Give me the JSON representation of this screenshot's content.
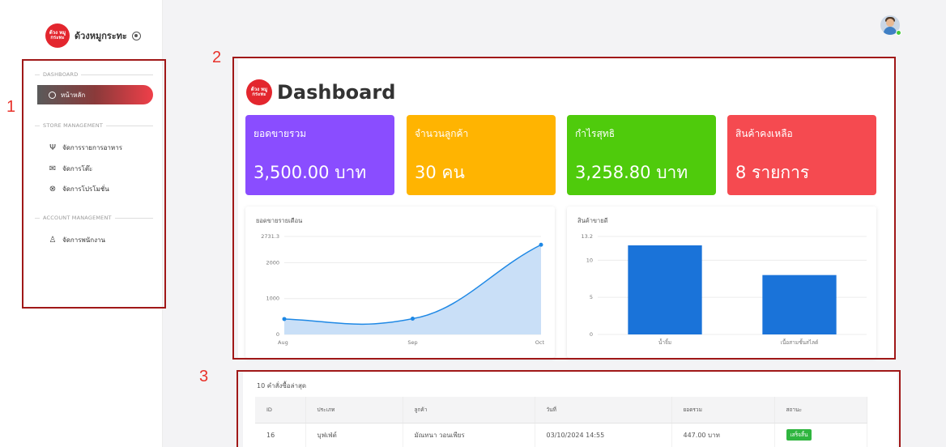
{
  "brand": {
    "logo_text": "ด้วง หมูกระทะ",
    "name": "ด้วงหมูกระทะ"
  },
  "sidebar": {
    "sections": [
      {
        "title": "DASHBOARD"
      },
      {
        "title": "STORE MANAGEMENT"
      },
      {
        "title": "ACCOUNT MANAGEMENT"
      }
    ],
    "active_item": {
      "label": "หน้าหลัก",
      "icon": "dashboard-icon"
    },
    "items": [
      {
        "label": "จัดการรายการอาหาร",
        "icon": "utensils-icon"
      },
      {
        "label": "จัดการโต๊ะ",
        "icon": "table-icon"
      },
      {
        "label": "จัดการโปรโมชั่น",
        "icon": "discount-icon"
      },
      {
        "label": "จัดการพนักงาน",
        "icon": "user-icon"
      }
    ]
  },
  "dashboard": {
    "title": "Dashboard",
    "stats": [
      {
        "label": "ยอดขายรวม",
        "value": "3,500.00 บาท",
        "color": "#8a4dff"
      },
      {
        "label": "จำนวนลูกค้า",
        "value": "30 คน",
        "color": "#ffb401"
      },
      {
        "label": "กำไรสุทธิ",
        "value": "3,258.80 บาท",
        "color": "#4fcb0c"
      },
      {
        "label": "สินค้าคงเหลือ",
        "value": "8 รายการ",
        "color": "#f54a50"
      }
    ]
  },
  "chart_data": [
    {
      "type": "area",
      "title": "ยอดขายรายเดือน",
      "x": [
        "Aug",
        "Sep",
        "Oct"
      ],
      "y_ticks": [
        "2731.3",
        "2000",
        "1000",
        "0"
      ],
      "ylim": [
        0,
        2731.3
      ],
      "series": [
        {
          "values": [
            430,
            440,
            2500
          ]
        }
      ],
      "color": "#1e88e5",
      "fill": "#c9dff7",
      "grid": true
    },
    {
      "type": "bar",
      "title": "สินค้าขายดี",
      "categories": [
        "น้ำจิ้ม",
        "เนื้อสามชั้นสไลด์"
      ],
      "y_ticks": [
        "13.2",
        "10",
        "5",
        "0"
      ],
      "ylim": [
        0,
        13.2
      ],
      "values": [
        12,
        8
      ],
      "color": "#1a73d9",
      "grid": true
    }
  ],
  "orders": {
    "title": "10 คำสั่งซื้อล่าสุด",
    "columns": [
      "ID",
      "ประเภท",
      "ลูกค้า",
      "วันที่",
      "ยอดรวม",
      "สถานะ"
    ],
    "rows": [
      {
        "id": "16",
        "type": "บุฟเฟ่ต์",
        "customer": "มัณทนา วอนเพียร",
        "date": "03/10/2024 14:55",
        "total": "447.00 บาท",
        "status": "เสร็จสิ้น"
      }
    ]
  },
  "annotations": [
    "1",
    "2",
    "3"
  ]
}
